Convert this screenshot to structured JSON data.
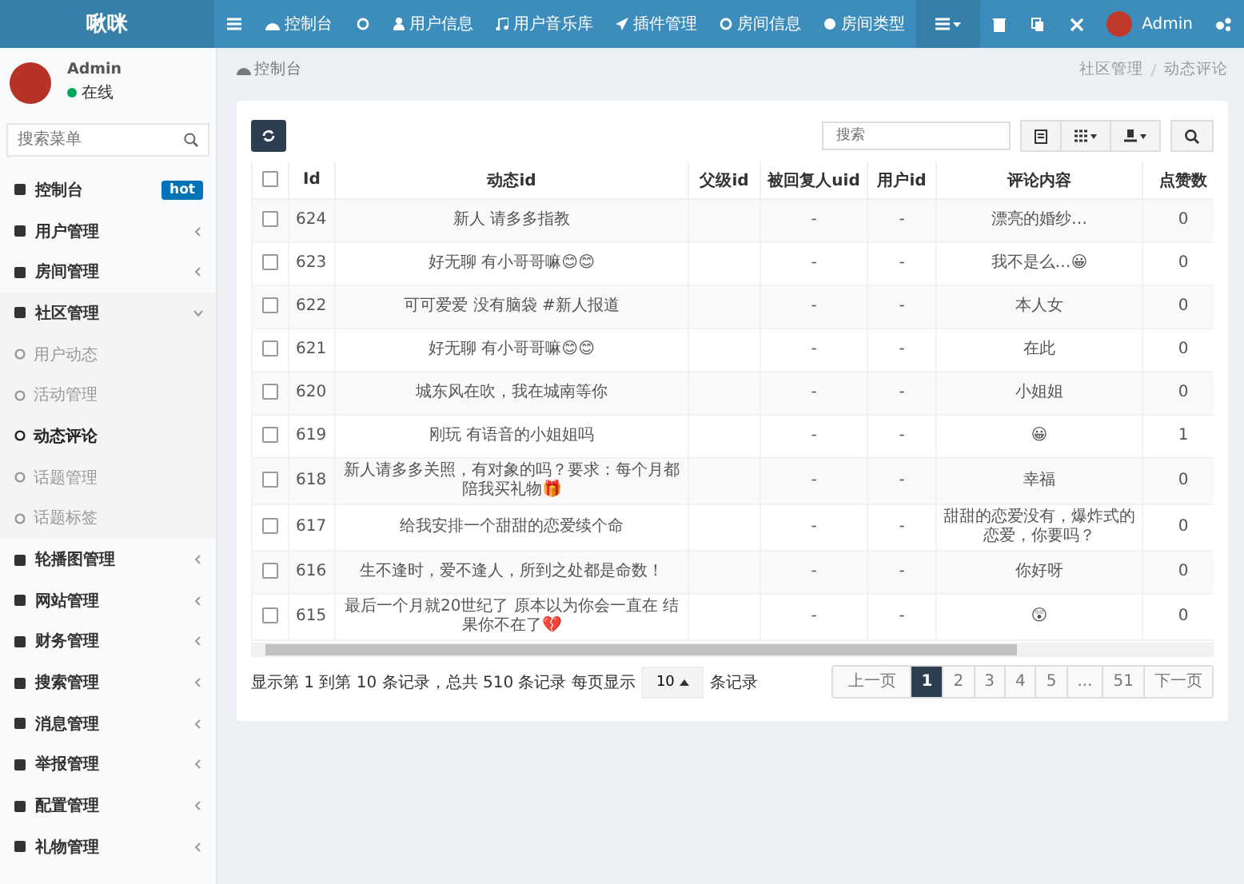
{
  "topbar": {
    "logo": "啾咪",
    "nav": [
      {
        "label": "控制台"
      },
      {
        "label": "用户信息"
      },
      {
        "label": "用户音乐库"
      },
      {
        "label": "插件管理"
      },
      {
        "label": "房间信息"
      },
      {
        "label": "房间类型"
      }
    ],
    "user": "Admin"
  },
  "sidebar": {
    "user": "Admin",
    "status": "在线",
    "search": {
      "placeholder": "搜索菜单"
    },
    "items": [
      {
        "label": "控制台",
        "badge": "hot"
      },
      {
        "label": "用户管理",
        "expanded": false
      },
      {
        "label": "房间管理",
        "expanded": false
      },
      {
        "label": "社区管理",
        "expanded": true,
        "children": [
          {
            "label": "用户动态",
            "selected": false
          },
          {
            "label": "活动管理",
            "selected": false
          },
          {
            "label": "动态评论",
            "selected": true
          },
          {
            "label": "话题管理",
            "selected": false
          },
          {
            "label": "话题标签",
            "selected": false
          }
        ]
      },
      {
        "label": "轮播图管理",
        "expanded": false
      },
      {
        "label": "网站管理",
        "expanded": false
      },
      {
        "label": "财务管理",
        "expanded": false
      },
      {
        "label": "搜索管理",
        "expanded": false
      },
      {
        "label": "消息管理",
        "expanded": false
      },
      {
        "label": "举报管理",
        "expanded": false
      },
      {
        "label": "配置管理",
        "expanded": false
      },
      {
        "label": "礼物管理",
        "expanded": false
      }
    ]
  },
  "breadcrumb_title": "控制台",
  "breadcrumb": [
    "社区管理",
    "动态评论"
  ],
  "toolbar": {
    "search": {
      "placeholder": "搜索"
    }
  },
  "table": {
    "all_checked": false,
    "columns": [
      "Id",
      "动态id",
      "父级id",
      "被回复人uid",
      "用户id",
      "评论内容",
      "点赞数"
    ],
    "rows": [
      {
        "checked": false,
        "cells": [
          "624",
          "新人 请多多指教",
          "",
          "-",
          "-",
          "漂亮的婚纱…",
          "0"
        ]
      },
      {
        "checked": false,
        "cells": [
          "623",
          "好无聊 有小哥哥嘛😊😊",
          "",
          "-",
          "-",
          "我不是么…😀",
          "0"
        ]
      },
      {
        "checked": false,
        "cells": [
          "622",
          "可可爱爱 没有脑袋 #新人报道",
          "",
          "-",
          "-",
          "本人女",
          "0"
        ]
      },
      {
        "checked": false,
        "cells": [
          "621",
          "好无聊 有小哥哥嘛😊😊",
          "",
          "-",
          "-",
          "在此",
          "0"
        ]
      },
      {
        "checked": false,
        "cells": [
          "620",
          "城东风在吹，我在城南等你",
          "",
          "-",
          "-",
          "小姐姐",
          "0"
        ]
      },
      {
        "checked": false,
        "cells": [
          "619",
          "刚玩 有语音的小姐姐吗",
          "",
          "-",
          "-",
          "😀",
          "1"
        ]
      },
      {
        "checked": false,
        "cells": [
          "618",
          "新人请多多关照，有对象的吗？要求：每个月都陪我买礼物🎁",
          "",
          "-",
          "-",
          "幸福",
          "0"
        ]
      },
      {
        "checked": false,
        "cells": [
          "617",
          "给我安排一个甜甜的恋爱续个命",
          "",
          "-",
          "-",
          "甜甜的恋爱没有，爆炸式的恋爱，你要吗？",
          "0"
        ]
      },
      {
        "checked": false,
        "cells": [
          "616",
          "生不逢时，爱不逢人，所到之处都是命数！",
          "",
          "-",
          "-",
          "你好呀",
          "0"
        ]
      },
      {
        "checked": false,
        "cells": [
          "615",
          "最后一个月就20世纪了 原本以为你会一直在 结果你不在了💔",
          "",
          "-",
          "-",
          "😲",
          "0"
        ]
      }
    ]
  },
  "footer": {
    "info_before": "显示第 1 到第 10 条记录，总共 510 条记录 每页显示",
    "page_size": "10",
    "info_after": "条记录",
    "pages": [
      {
        "label": "上一页",
        "selected": false
      },
      {
        "label": "1",
        "selected": true
      },
      {
        "label": "2",
        "selected": false
      },
      {
        "label": "3",
        "selected": false
      },
      {
        "label": "4",
        "selected": false
      },
      {
        "label": "5",
        "selected": false
      },
      {
        "label": "...",
        "selected": false
      },
      {
        "label": "51",
        "selected": false
      },
      {
        "label": "下一页",
        "selected": false
      }
    ]
  }
}
